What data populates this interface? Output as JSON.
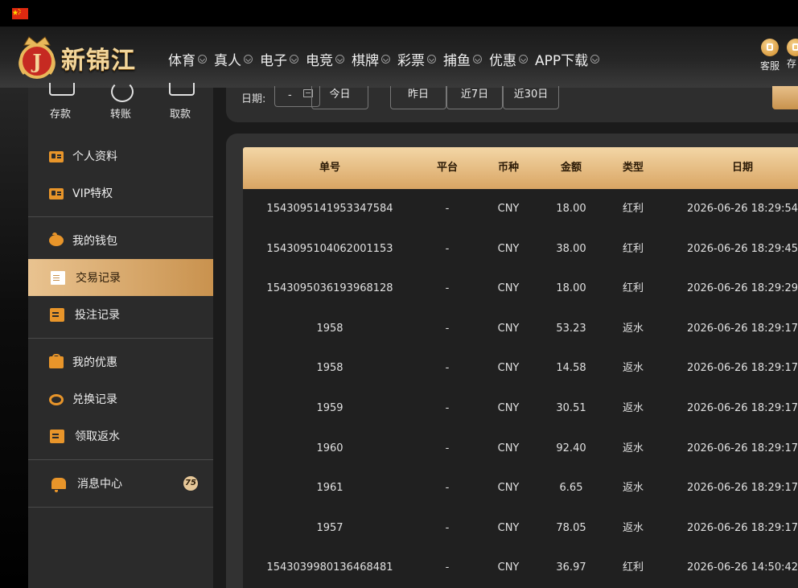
{
  "header": {
    "logo_text": "新锦江",
    "nav": [
      "体育",
      "真人",
      "电子",
      "电竞",
      "棋牌",
      "彩票",
      "捕鱼",
      "优惠",
      "APP下载"
    ],
    "service_label": "客服",
    "deposit_label_partial": "存"
  },
  "sidebar": {
    "quick": [
      "存款",
      "转账",
      "取款"
    ],
    "groups": [
      [
        {
          "label": "个人资料",
          "icon": "card"
        },
        {
          "label": "VIP特权",
          "icon": "card"
        }
      ],
      [
        {
          "label": "我的钱包",
          "icon": "pig"
        },
        {
          "label": "交易记录",
          "icon": "doc",
          "active": true
        },
        {
          "label": "投注记录",
          "icon": "list"
        }
      ],
      [
        {
          "label": "我的优惠",
          "icon": "bag"
        },
        {
          "label": "兑换记录",
          "icon": "coin"
        },
        {
          "label": "领取返水",
          "icon": "list"
        }
      ],
      [
        {
          "label": "消息中心",
          "icon": "bell",
          "badge": "75"
        }
      ]
    ]
  },
  "filter": {
    "date_label": "日期:",
    "date_value": "-",
    "quick_ranges": [
      "今日",
      "昨日",
      "近7日",
      "近30日"
    ]
  },
  "table": {
    "columns": [
      "单号",
      "平台",
      "币种",
      "金额",
      "类型",
      "日期"
    ],
    "rows": [
      [
        "1543095141953347584",
        "-",
        "CNY",
        "18.00",
        "红利",
        "2026-06-26 18:29:54"
      ],
      [
        "1543095104062001153",
        "-",
        "CNY",
        "38.00",
        "红利",
        "2026-06-26 18:29:45"
      ],
      [
        "1543095036193968128",
        "-",
        "CNY",
        "18.00",
        "红利",
        "2026-06-26 18:29:29"
      ],
      [
        "1958",
        "-",
        "CNY",
        "53.23",
        "返水",
        "2026-06-26 18:29:17"
      ],
      [
        "1958",
        "-",
        "CNY",
        "14.58",
        "返水",
        "2026-06-26 18:29:17"
      ],
      [
        "1959",
        "-",
        "CNY",
        "30.51",
        "返水",
        "2026-06-26 18:29:17"
      ],
      [
        "1960",
        "-",
        "CNY",
        "92.40",
        "返水",
        "2026-06-26 18:29:17"
      ],
      [
        "1961",
        "-",
        "CNY",
        "6.65",
        "返水",
        "2026-06-26 18:29:17"
      ],
      [
        "1957",
        "-",
        "CNY",
        "78.05",
        "返水",
        "2026-06-26 18:29:17"
      ],
      [
        "1543039980136468481",
        "-",
        "CNY",
        "36.97",
        "红利",
        "2026-06-26 14:50:42"
      ]
    ]
  },
  "colors": {
    "accent_gold": "#e0b06e",
    "icon_orange": "#e8952a",
    "header_bg": "#262626",
    "panel_bg": "#323232",
    "row_bg": "#202020"
  }
}
